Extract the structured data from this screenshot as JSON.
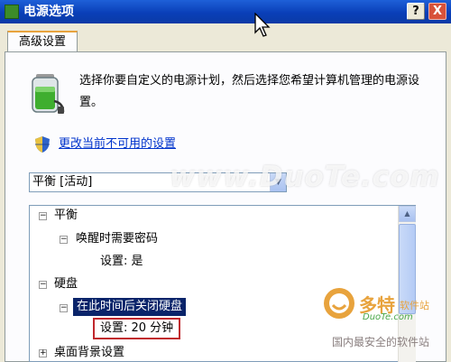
{
  "window": {
    "title": "电源选项",
    "help_label": "?",
    "close_label": "X"
  },
  "tabs": [
    {
      "label": "高级设置",
      "active": true
    }
  ],
  "description": "选择你要自定义的电源计划，然后选择您希望计算机管理的电源设置。",
  "change_link": "更改当前不可用的设置",
  "plan_select": {
    "value": "平衡 [活动]"
  },
  "tree": {
    "items": [
      {
        "label": "平衡",
        "expander": "−"
      },
      {
        "label": "唤醒时需要密码",
        "expander": "−"
      },
      {
        "label": "设置: 是"
      },
      {
        "label": "硬盘",
        "expander": "−"
      },
      {
        "label": "在此时间后关闭硬盘",
        "expander": "−"
      },
      {
        "label": "设置: 20 分钟"
      },
      {
        "label": "桌面背景设置",
        "expander": "+"
      }
    ]
  },
  "watermarks": {
    "center": "www.DuoTe.com",
    "brand": "多特",
    "brand_sub": "软件站",
    "brand_url": "DuoTe.com",
    "slogan": "国内最安全的软件站"
  },
  "colors": {
    "titlebar": "#0a3fb8",
    "selection": "#0a246a",
    "highlight_box": "#c0272d",
    "link": "#0033cc"
  },
  "icons": [
    "battery-icon",
    "shield-icon",
    "cursor-icon"
  ]
}
